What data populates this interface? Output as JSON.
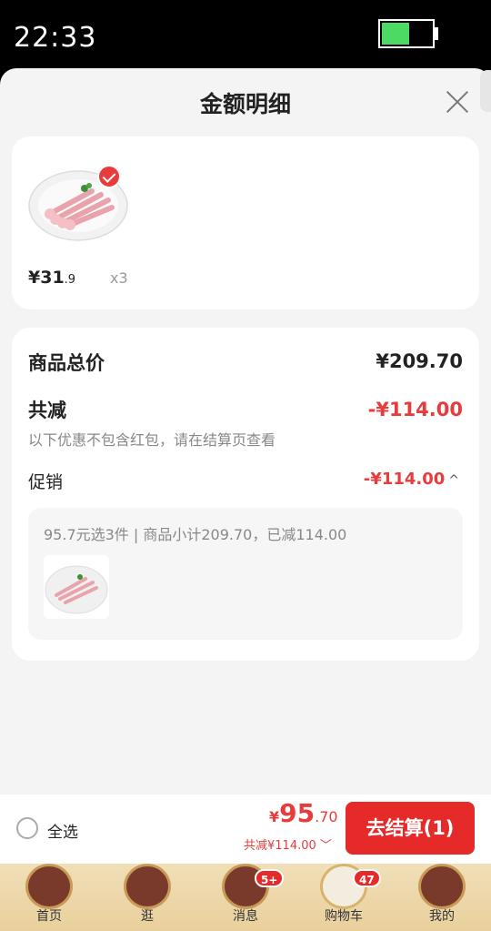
{
  "status_bar": {
    "time": "22:33",
    "battery_level": 0.55
  },
  "sheet": {
    "title": "金额明细"
  },
  "product": {
    "price_int": "¥31",
    "price_dec": ".9",
    "quantity": "x3",
    "image_icon": "duck-feet-plate-image",
    "selected": true
  },
  "summary": {
    "total_label": "商品总价",
    "total_value": "¥209.70",
    "discount_label": "共减",
    "discount_value": "-¥114.00",
    "note": "以下优惠不包含红包，请在结算页查看",
    "promo_label": "促销",
    "promo_value": "-¥114.00",
    "promo_caret": "^",
    "promo_detail": "95.7元选3件 | 商品小计209.70，已减114.00"
  },
  "checkout": {
    "select_all": "全选",
    "currency": "¥",
    "price_int": "95",
    "price_dec": ".70",
    "discount_text": "共减¥114.00 ﹀",
    "button_label": "去结算(1)"
  },
  "tabs": [
    {
      "label": "首页",
      "icon": "home-palace-icon"
    },
    {
      "label": "逛",
      "icon": "browse-figure-icon"
    },
    {
      "label": "消息",
      "icon": "message-icon",
      "badge": "5+"
    },
    {
      "label": "购物车",
      "icon": "cart-deer-icon",
      "badge": "47"
    },
    {
      "label": "我的",
      "icon": "profile-icon"
    }
  ],
  "colors": {
    "accent": "#e93b3b",
    "button": "#e62a2a",
    "tabbar": "#f1dfb8"
  }
}
